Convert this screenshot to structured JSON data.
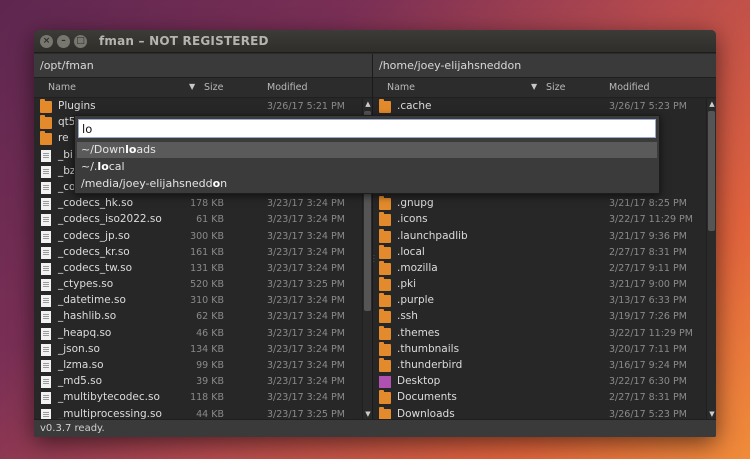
{
  "window": {
    "title": "fman – NOT REGISTERED"
  },
  "left": {
    "path": "/opt/fman",
    "headers": {
      "name": "Name",
      "size": "Size",
      "modified": "Modified"
    },
    "rows": [
      {
        "type": "folder",
        "name": "Plugins",
        "size": "",
        "modified": "3/26/17 5:21 PM"
      },
      {
        "type": "folder",
        "name": "qt5",
        "size": "",
        "modified": ""
      },
      {
        "type": "folder",
        "name": "re",
        "size": "",
        "modified": ""
      },
      {
        "type": "file",
        "name": "_bi",
        "size": "",
        "modified": ""
      },
      {
        "type": "file",
        "name": "_bz",
        "size": "",
        "modified": ""
      },
      {
        "type": "file",
        "name": "_co",
        "size": "",
        "modified": ""
      },
      {
        "type": "file",
        "name": "_codecs_hk.so",
        "size": "178 KB",
        "modified": "3/23/17 3:24 PM"
      },
      {
        "type": "file",
        "name": "_codecs_iso2022.so",
        "size": "61 KB",
        "modified": "3/23/17 3:24 PM"
      },
      {
        "type": "file",
        "name": "_codecs_jp.so",
        "size": "300 KB",
        "modified": "3/23/17 3:24 PM"
      },
      {
        "type": "file",
        "name": "_codecs_kr.so",
        "size": "161 KB",
        "modified": "3/23/17 3:24 PM"
      },
      {
        "type": "file",
        "name": "_codecs_tw.so",
        "size": "131 KB",
        "modified": "3/23/17 3:24 PM"
      },
      {
        "type": "file",
        "name": "_ctypes.so",
        "size": "520 KB",
        "modified": "3/23/17 3:25 PM"
      },
      {
        "type": "file",
        "name": "_datetime.so",
        "size": "310 KB",
        "modified": "3/23/17 3:24 PM"
      },
      {
        "type": "file",
        "name": "_hashlib.so",
        "size": "62 KB",
        "modified": "3/23/17 3:24 PM"
      },
      {
        "type": "file",
        "name": "_heapq.so",
        "size": "46 KB",
        "modified": "3/23/17 3:24 PM"
      },
      {
        "type": "file",
        "name": "_json.so",
        "size": "134 KB",
        "modified": "3/23/17 3:24 PM"
      },
      {
        "type": "file",
        "name": "_lzma.so",
        "size": "99 KB",
        "modified": "3/23/17 3:24 PM"
      },
      {
        "type": "file",
        "name": "_md5.so",
        "size": "39 KB",
        "modified": "3/23/17 3:24 PM"
      },
      {
        "type": "file",
        "name": "_multibytecodec.so",
        "size": "118 KB",
        "modified": "3/23/17 3:24 PM"
      },
      {
        "type": "file",
        "name": "_multiprocessing.so",
        "size": "44 KB",
        "modified": "3/23/17 3:25 PM"
      }
    ]
  },
  "right": {
    "path": "/home/joey-elijahsneddon",
    "headers": {
      "name": "Name",
      "size": "Size",
      "modified": "Modified"
    },
    "rows": [
      {
        "type": "folder",
        "name": ".cache",
        "size": "",
        "modified": "3/26/17 5:23 PM"
      },
      {
        "type": "folder",
        "name": "",
        "size": "",
        "modified": "05 PM"
      },
      {
        "type": "folder",
        "name": "",
        "size": "",
        "modified": "24 PM"
      },
      {
        "type": "folder",
        "name": "",
        "size": "",
        "modified": "23 PM"
      },
      {
        "type": "folder",
        "name": "",
        "size": "",
        "modified": "1:37 PM"
      },
      {
        "type": "folder",
        "name": "",
        "size": "",
        "modified": "17 PM"
      },
      {
        "type": "folder",
        "name": ".gnupg",
        "size": "",
        "modified": "3/21/17 8:25 PM"
      },
      {
        "type": "folder",
        "name": ".icons",
        "size": "",
        "modified": "3/22/17 11:29 PM"
      },
      {
        "type": "folder",
        "name": ".launchpadlib",
        "size": "",
        "modified": "3/21/17 9:36 PM"
      },
      {
        "type": "folder",
        "name": ".local",
        "size": "",
        "modified": "2/27/17 8:31 PM"
      },
      {
        "type": "folder",
        "name": ".mozilla",
        "size": "",
        "modified": "2/27/17 9:11 PM"
      },
      {
        "type": "folder",
        "name": ".pki",
        "size": "",
        "modified": "3/21/17 9:00 PM"
      },
      {
        "type": "folder",
        "name": ".purple",
        "size": "",
        "modified": "3/13/17 6:33 PM"
      },
      {
        "type": "folder",
        "name": ".ssh",
        "size": "",
        "modified": "3/19/17 7:26 PM"
      },
      {
        "type": "folder",
        "name": ".themes",
        "size": "",
        "modified": "3/22/17 11:29 PM"
      },
      {
        "type": "folder",
        "name": ".thumbnails",
        "size": "",
        "modified": "3/20/17 7:11 PM"
      },
      {
        "type": "folder",
        "name": ".thunderbird",
        "size": "",
        "modified": "3/16/17 9:24 PM"
      },
      {
        "type": "desktop",
        "name": "Desktop",
        "size": "",
        "modified": "3/22/17 6:30 PM"
      },
      {
        "type": "folder",
        "name": "Documents",
        "size": "",
        "modified": "2/27/17 8:31 PM"
      },
      {
        "type": "folder",
        "name": "Downloads",
        "size": "",
        "modified": "3/26/17 5:23 PM"
      }
    ]
  },
  "quick_search": {
    "query": "lo",
    "suggestions": [
      {
        "before": "~/Down",
        "match": "lo",
        "after": "ads",
        "selected": true
      },
      {
        "before": "~/.",
        "match": "lo",
        "after": "cal",
        "selected": false
      },
      {
        "before": "/media/joey-elijahsnedd",
        "match": "o",
        "after": "n",
        "selected": false
      }
    ]
  },
  "status": "v0.3.7 ready.",
  "colors": {
    "folder": "#e38b2c",
    "desktop": "#b050b0",
    "selection": "#5a5a5a"
  }
}
